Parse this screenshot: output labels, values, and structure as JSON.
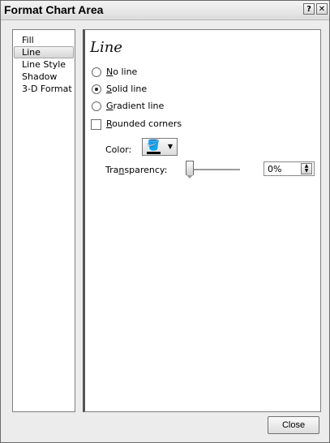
{
  "window": {
    "title": "Format Chart Area",
    "help_glyph": "?",
    "close_glyph": "✕"
  },
  "nav": {
    "items": [
      {
        "label": "Fill",
        "selected": false
      },
      {
        "label": "Line",
        "selected": true
      },
      {
        "label": "Line Style",
        "selected": false
      },
      {
        "label": "Shadow",
        "selected": false
      },
      {
        "label": "3-D Format",
        "selected": false
      }
    ]
  },
  "panel": {
    "title": "Line",
    "options": {
      "no_line": {
        "mnemonic": "N",
        "rest": "o line",
        "checked": false
      },
      "solid_line": {
        "mnemonic": "S",
        "rest": "olid line",
        "checked": true
      },
      "gradient_line": {
        "mnemonic": "G",
        "rest": "radient line",
        "checked": false
      }
    },
    "rounded": {
      "mnemonic": "R",
      "rest": "ounded corners",
      "checked": false
    },
    "color": {
      "label": "Color:",
      "icon": "paint-bucket-icon",
      "value": "#000000",
      "dropdown_glyph": "▼"
    },
    "transparency": {
      "label_pre": "Tra",
      "mnemonic": "n",
      "label_post": "sparency:",
      "value_text": "0%",
      "value_fraction": 0
    }
  },
  "footer": {
    "close_label": "Close"
  }
}
